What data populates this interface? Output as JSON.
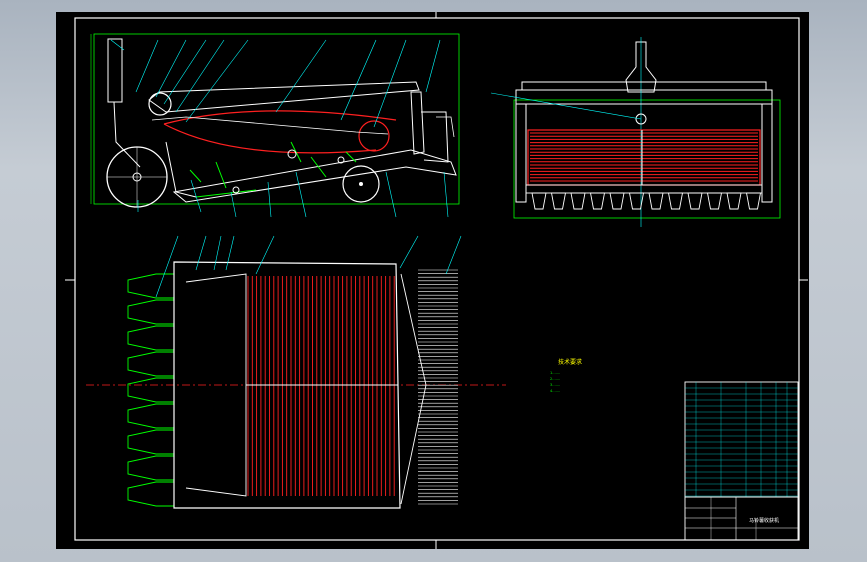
{
  "notes": {
    "title": "技术要求",
    "lines": [
      "1.……",
      "2.……",
      "3.……",
      "4.……"
    ]
  },
  "title_block": {
    "drawing_name": "马铃薯收获机"
  },
  "colors": {
    "background": "#000000",
    "frame": "#ffffff",
    "leader": "#00ffff",
    "outline": "#00ff00",
    "red": "#ff2020",
    "white": "#ffffff",
    "yellow": "#ffff00"
  }
}
